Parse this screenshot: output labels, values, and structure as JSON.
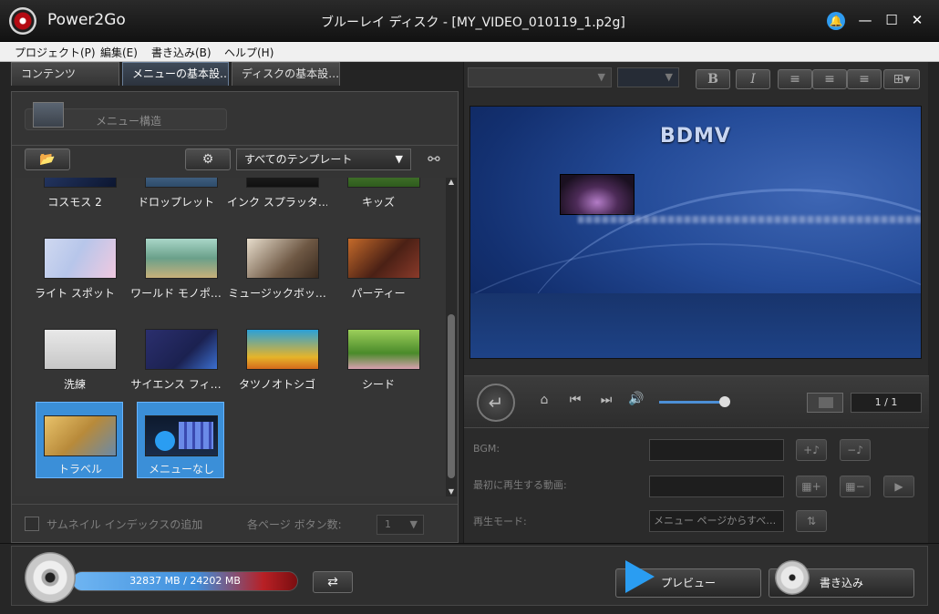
{
  "titlebar": {
    "app_name": "Power2Go",
    "window_title": "ブルーレイ ディスク - [MY_VIDEO_010119_1.p2g]",
    "bell_icon": "bell-icon",
    "minimize": "—",
    "maximize": "☐",
    "close": "✕"
  },
  "menubar": {
    "items": [
      "プロジェクト(P)",
      "編集(E)",
      "書き込み(B)",
      "ヘルプ(H)"
    ]
  },
  "left": {
    "tabs": [
      "コンテンツ",
      "メニューの基本設…",
      "ディスクの基本設…"
    ],
    "menu_structure_label": "メニュー構造",
    "template_filter": "すべてのテンプレート",
    "templates": [
      {
        "label": "コスモス 2"
      },
      {
        "label": "ドロップレット"
      },
      {
        "label": "インク スプラッタ…"
      },
      {
        "label": "キッズ"
      },
      {
        "label": "ライト スポット"
      },
      {
        "label": "ワールド モノポ…"
      },
      {
        "label": "ミュージックボッ…"
      },
      {
        "label": "パーティー"
      },
      {
        "label": "洗練"
      },
      {
        "label": "サイエンス フィ…"
      },
      {
        "label": "タツノオトシゴ"
      },
      {
        "label": "シード"
      },
      {
        "label": "トラベル"
      },
      {
        "label": "メニューなし"
      }
    ],
    "thumbnail_index_label": "サムネイル インデックスの追加",
    "buttons_per_page_label": "各ページ ボタン数:",
    "buttons_per_page_value": "1"
  },
  "right": {
    "bold_label": "B",
    "italic_label": "I",
    "preview_title": "BDMV",
    "page_indicator": "1 / 1",
    "bgm_label": "BGM:",
    "first_play_label": "最初に再生する動画:",
    "play_mode_label": "再生モード:",
    "play_mode_value": "メニュー ページからすべ…"
  },
  "bottom": {
    "capacity_text": "32837 MB / 24202 MB",
    "preview_label": "プレビュー",
    "burn_label": "書き込み"
  },
  "colors": {
    "accent_blue": "#3b8fd8",
    "title_bar": "#1a1a1a",
    "capacity_red": "#b82025"
  }
}
